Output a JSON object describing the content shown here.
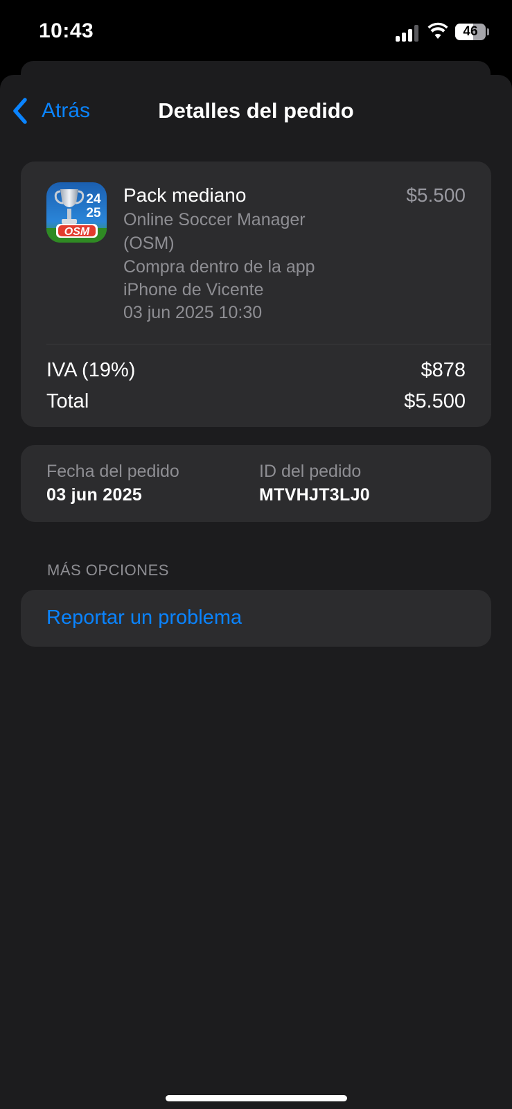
{
  "status_bar": {
    "time": "10:43",
    "battery": "46",
    "signal_bars_active": 3
  },
  "nav": {
    "back_label": "Atrás",
    "title": "Detalles del pedido"
  },
  "product": {
    "name": "Pack mediano",
    "price": "$5.500",
    "app_name_line1": "Online Soccer Manager",
    "app_name_line2": "(OSM)",
    "purchase_type": "Compra dentro de la app",
    "device": "iPhone de Vicente",
    "datetime": "03 jun 2025 10:30",
    "icon": {
      "year_top": "24",
      "year_bottom": "25",
      "logo": "OSM"
    }
  },
  "totals": {
    "tax_label": "IVA (19%)",
    "tax_value": "$878",
    "total_label": "Total",
    "total_value": "$5.500"
  },
  "order": {
    "date_label": "Fecha del pedido",
    "date_value": "03 jun 2025",
    "id_label": "ID del pedido",
    "id_value": "MTVHJT3LJ0"
  },
  "more_options": {
    "header": "MÁS OPCIONES",
    "report_label": "Reportar un problema"
  },
  "colors": {
    "accent": "#0a84ff",
    "sheet_bg": "#1c1c1e",
    "card_bg": "#2c2c2e",
    "secondary_text": "#8e8e93"
  }
}
